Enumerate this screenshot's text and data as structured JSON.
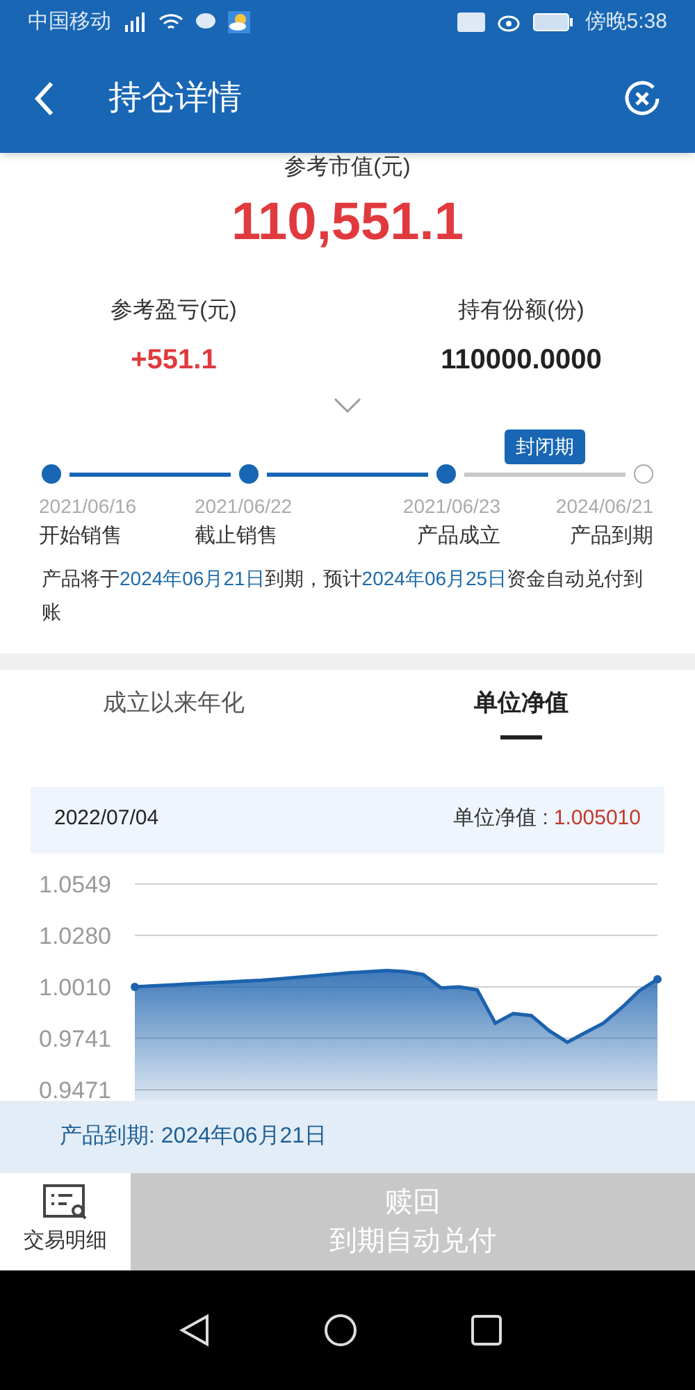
{
  "status_bar": {
    "carrier": "中国移动",
    "time": "傍晚5:38"
  },
  "header": {
    "title": "持仓详情"
  },
  "summary": {
    "label": "参考市值(元)",
    "value": "110,551.1"
  },
  "stats": [
    {
      "label": "参考盈亏(元)",
      "value": "+551.1",
      "kind": "gain"
    },
    {
      "label": "持有份额(份)",
      "value": "110000.0000",
      "kind": "plain"
    }
  ],
  "timeline": {
    "current_tag": "封闭期",
    "steps": [
      {
        "date": "2021/06/16",
        "label": "开始销售",
        "done": true
      },
      {
        "date": "2021/06/22",
        "label": "截止销售",
        "done": true
      },
      {
        "date": "2021/06/23",
        "label": "产品成立",
        "done": true
      },
      {
        "date": "2024/06/21",
        "label": "产品到期",
        "done": false
      }
    ],
    "note": [
      {
        "text": "产品将于",
        "highlight": false
      },
      {
        "text": "2024年06月21日",
        "highlight": true
      },
      {
        "text": "到期，预计",
        "highlight": false
      },
      {
        "text": "2024年06月25日",
        "highlight": true
      },
      {
        "text": "资金自动兑付到账",
        "highlight": false
      }
    ]
  },
  "tabs": [
    {
      "label": "成立以来年化",
      "selected": false
    },
    {
      "label": "单位净值",
      "selected": true
    }
  ],
  "nav_info": {
    "date": "2022/07/04",
    "label": "单位净值 :",
    "value": "1.005010"
  },
  "chart_data": {
    "type": "area",
    "grid": true,
    "ylim": [
      0.9471,
      1.0549
    ],
    "yticks": [
      {
        "value": 1.0549,
        "label": "1.0549"
      },
      {
        "value": 1.028,
        "label": "1.0280"
      },
      {
        "value": 1.001,
        "label": "1.0010"
      },
      {
        "value": 0.9741,
        "label": "0.9741"
      },
      {
        "value": 0.9471,
        "label": "0.9471"
      }
    ],
    "series": [
      {
        "color": "#1c62ad",
        "values": [
          1.001,
          1.0015,
          1.002,
          1.0025,
          1.003,
          1.0035,
          1.004,
          1.0045,
          1.0052,
          1.006,
          1.0068,
          1.0076,
          1.0084,
          1.009,
          1.0096,
          1.009,
          1.0075,
          1.0005,
          1.001,
          0.9995,
          0.982,
          0.987,
          0.986,
          0.978,
          0.972,
          0.977,
          0.982,
          0.99,
          0.999,
          1.005
        ]
      }
    ]
  },
  "maturity": "产品到期: 2024年06月21日",
  "actions": {
    "details": "交易明细",
    "redeem": {
      "title": "赎回",
      "subtitle": "到期自动兑付",
      "disabled": true
    }
  }
}
